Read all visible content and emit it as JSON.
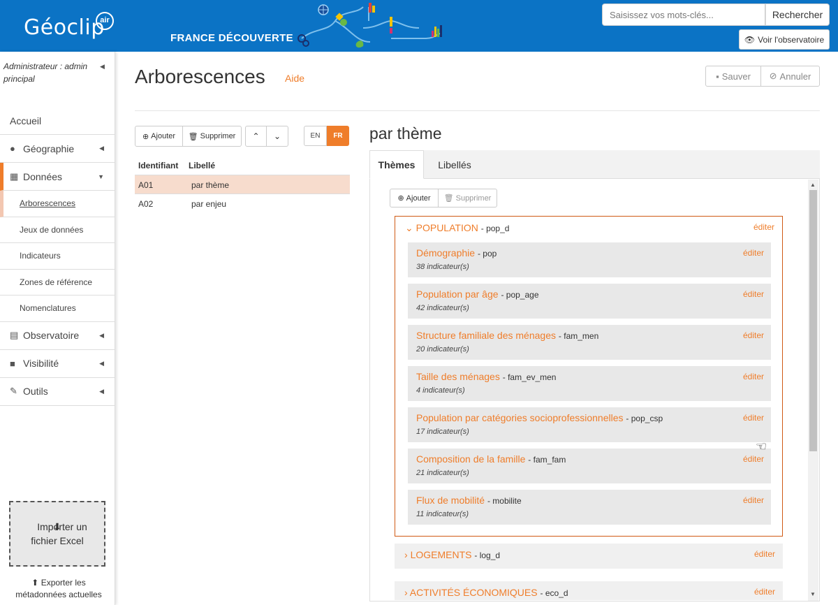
{
  "header": {
    "logo_text": "Géoclip",
    "logo_badge": "air",
    "site_name": "FRANCE DÉCOUVERTE",
    "search_placeholder": "Saisissez vos mots-clés...",
    "search_button": "Rechercher",
    "observatory_button": "Voir l'observatoire",
    "bg_color": "#0b73c5"
  },
  "sidebar": {
    "admin_label": "Administrateur : admin principal",
    "items": [
      {
        "label": "Accueil",
        "icon": ""
      },
      {
        "label": "Géographie",
        "icon": "globe-icon"
      },
      {
        "label": "Données",
        "icon": "grid-icon"
      },
      {
        "label": "Observatoire",
        "icon": "list-icon"
      },
      {
        "label": "Visibilité",
        "icon": "lock-icon"
      },
      {
        "label": "Outils",
        "icon": "wrench-icon"
      }
    ],
    "subitems": [
      "Arborescences",
      "Jeux de données",
      "Indicateurs",
      "Zones de référence",
      "Nomenclatures"
    ],
    "import_label": "Importer un fichier Excel",
    "export_label": "Exporter les métadonnées actuelles"
  },
  "page": {
    "title": "Arborescences",
    "help_link": "Aide",
    "save_button": "Sauver",
    "cancel_button": "Annuler",
    "accent_color": "#ef7d2a"
  },
  "left_toolbar": {
    "add": "Ajouter",
    "delete": "Supprimer",
    "lang_en": "EN",
    "lang_fr": "FR"
  },
  "table": {
    "columns": [
      "Identifiant",
      "Libellé"
    ],
    "rows": [
      {
        "id": "A01",
        "label": "par thème",
        "selected": true
      },
      {
        "id": "A02",
        "label": "par enjeu",
        "selected": false
      }
    ]
  },
  "detail": {
    "title": "par thème",
    "tabs": [
      "Thèmes",
      "Libellés"
    ],
    "active_tab": "Thèmes",
    "add": "Ajouter",
    "delete": "Supprimer",
    "edit_label": "éditer",
    "groups": [
      {
        "title": "POPULATION",
        "code": "pop_d",
        "expanded": true,
        "children": [
          {
            "title": "Démographie",
            "code": "pop",
            "count": "38 indicateur(s)"
          },
          {
            "title": "Population par âge",
            "code": "pop_age",
            "count": "42 indicateur(s)"
          },
          {
            "title": "Structure familiale des ménages",
            "code": "fam_men",
            "count": "20 indicateur(s)"
          },
          {
            "title": "Taille des ménages",
            "code": "fam_ev_men",
            "count": "4 indicateur(s)"
          },
          {
            "title": "Population par catégories socioprofessionnelles",
            "code": "pop_csp",
            "count": "17 indicateur(s)"
          },
          {
            "title": "Composition de la famille",
            "code": "fam_fam",
            "count": "21 indicateur(s)"
          },
          {
            "title": "Flux de mobilité",
            "code": "mobilite",
            "count": "11 indicateur(s)"
          }
        ]
      },
      {
        "title": "LOGEMENTS",
        "code": "log_d",
        "expanded": false
      },
      {
        "title": "ACTIVITÉS ÉCONOMIQUES",
        "code": "eco_d",
        "expanded": false
      }
    ]
  }
}
